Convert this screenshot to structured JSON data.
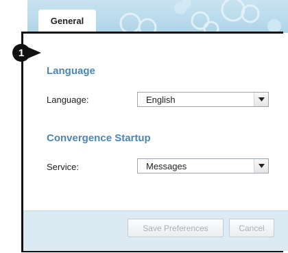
{
  "tabs": [
    {
      "label": "General",
      "active": true
    }
  ],
  "callout": {
    "number": "1"
  },
  "sections": {
    "language": {
      "title": "Language",
      "field_label": "Language:",
      "selected": "English"
    },
    "startup": {
      "title": "Convergence Startup",
      "field_label": "Service:",
      "selected": "Messages"
    }
  },
  "footer": {
    "save_label": "Save Preferences",
    "cancel_label": "Cancel"
  },
  "icons": {
    "dropdown": "chevron-down-icon"
  },
  "colors": {
    "section_title": "#4a86b7",
    "banner": "#b9dbec",
    "footer": "#dceaf3",
    "disabled_text": "#a9b0b6"
  }
}
